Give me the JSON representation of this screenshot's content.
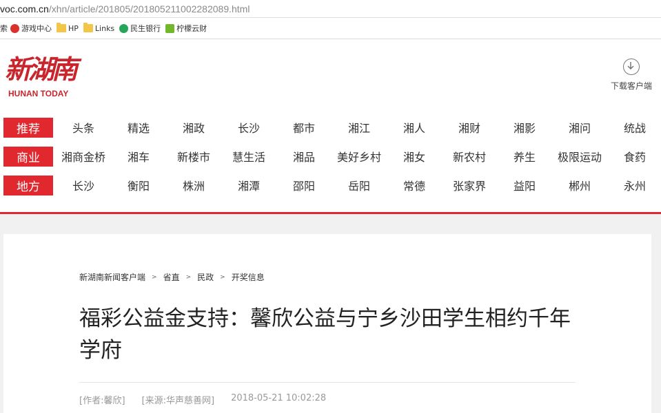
{
  "browser": {
    "url_host": "voc.com.cn",
    "url_path": "/xhn/article/201805/201805211002282089.html",
    "bookmarks": [
      {
        "label": "索",
        "icon": "search-fragment"
      },
      {
        "label": "游戏中心",
        "icon": "game-center-icon"
      },
      {
        "label": "HP",
        "icon": "folder-icon"
      },
      {
        "label": "Links",
        "icon": "folder-icon"
      },
      {
        "label": "民生银行",
        "icon": "bank-icon"
      },
      {
        "label": "柠檬云财",
        "icon": "lemon-icon"
      }
    ]
  },
  "header": {
    "logo_text": "新湖南",
    "logo_sub": "HUNAN TODAY",
    "download_label": "下载客户端"
  },
  "nav": {
    "rows": [
      {
        "category": "推荐",
        "items": [
          "头条",
          "精选",
          "湘政",
          "长沙",
          "都市",
          "湘江",
          "湘人",
          "湘财",
          "湘影",
          "湘问",
          "统战"
        ]
      },
      {
        "category": "商业",
        "items": [
          "湘商金桥",
          "湘车",
          "新楼市",
          "慧生活",
          "湘品",
          "美好乡村",
          "湘女",
          "新农村",
          "养生",
          "极限运动",
          "食药"
        ]
      },
      {
        "category": "地方",
        "items": [
          "长沙",
          "衡阳",
          "株洲",
          "湘潭",
          "邵阳",
          "岳阳",
          "常德",
          "张家界",
          "益阳",
          "郴州",
          "永州"
        ]
      }
    ]
  },
  "article": {
    "breadcrumb": [
      "新湖南新闻客户端",
      "省直",
      "民政",
      "开奖信息"
    ],
    "breadcrumb_separator": ">",
    "title": "福彩公益金支持：馨欣公益与宁乡沙田学生相约千年学府",
    "author": "[作者:馨欣]",
    "source": "[来源:华声慈善网]",
    "datetime": "2018-05-21 10:02:28"
  },
  "colors": {
    "accent": "#e2282f",
    "logo": "#c8262c"
  }
}
